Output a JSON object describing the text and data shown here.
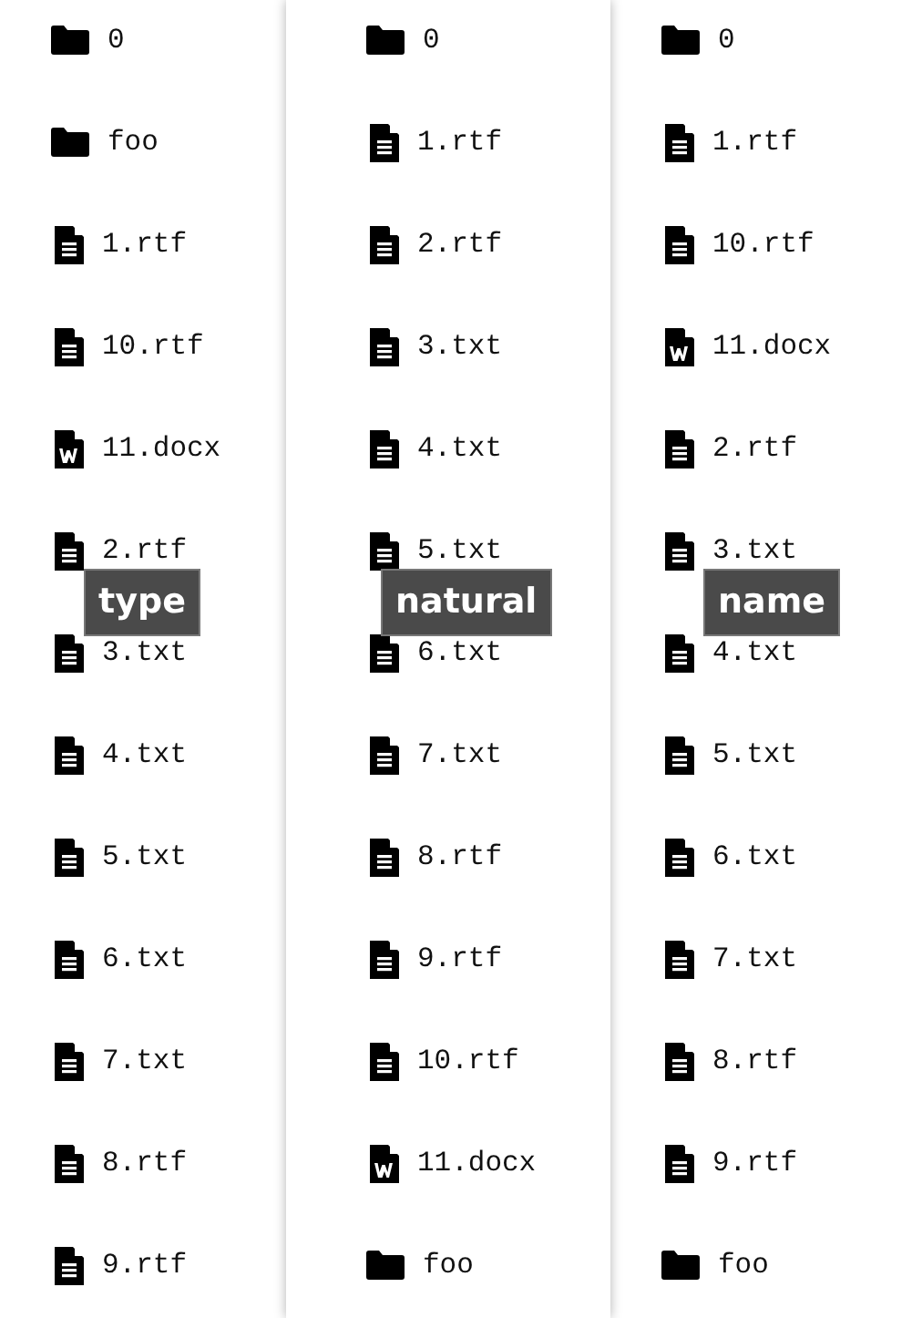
{
  "columns": [
    {
      "label": "type",
      "items": [
        {
          "name": "0",
          "kind": "folder"
        },
        {
          "name": "foo",
          "kind": "folder"
        },
        {
          "name": "1.rtf",
          "kind": "text"
        },
        {
          "name": "10.rtf",
          "kind": "text"
        },
        {
          "name": "11.docx",
          "kind": "word"
        },
        {
          "name": "2.rtf",
          "kind": "text"
        },
        {
          "name": "3.txt",
          "kind": "text"
        },
        {
          "name": "4.txt",
          "kind": "text"
        },
        {
          "name": "5.txt",
          "kind": "text"
        },
        {
          "name": "6.txt",
          "kind": "text"
        },
        {
          "name": "7.txt",
          "kind": "text"
        },
        {
          "name": "8.rtf",
          "kind": "text"
        },
        {
          "name": "9.rtf",
          "kind": "text"
        }
      ]
    },
    {
      "label": "natural",
      "items": [
        {
          "name": "0",
          "kind": "folder"
        },
        {
          "name": "1.rtf",
          "kind": "text"
        },
        {
          "name": "2.rtf",
          "kind": "text"
        },
        {
          "name": "3.txt",
          "kind": "text"
        },
        {
          "name": "4.txt",
          "kind": "text"
        },
        {
          "name": "5.txt",
          "kind": "text"
        },
        {
          "name": "6.txt",
          "kind": "text"
        },
        {
          "name": "7.txt",
          "kind": "text"
        },
        {
          "name": "8.rtf",
          "kind": "text"
        },
        {
          "name": "9.rtf",
          "kind": "text"
        },
        {
          "name": "10.rtf",
          "kind": "text"
        },
        {
          "name": "11.docx",
          "kind": "word"
        },
        {
          "name": "foo",
          "kind": "folder"
        }
      ]
    },
    {
      "label": "name",
      "items": [
        {
          "name": "0",
          "kind": "folder"
        },
        {
          "name": "1.rtf",
          "kind": "text"
        },
        {
          "name": "10.rtf",
          "kind": "text"
        },
        {
          "name": "11.docx",
          "kind": "word"
        },
        {
          "name": "2.rtf",
          "kind": "text"
        },
        {
          "name": "3.txt",
          "kind": "text"
        },
        {
          "name": "4.txt",
          "kind": "text"
        },
        {
          "name": "5.txt",
          "kind": "text"
        },
        {
          "name": "6.txt",
          "kind": "text"
        },
        {
          "name": "7.txt",
          "kind": "text"
        },
        {
          "name": "8.rtf",
          "kind": "text"
        },
        {
          "name": "9.rtf",
          "kind": "text"
        },
        {
          "name": "foo",
          "kind": "folder"
        }
      ]
    }
  ]
}
